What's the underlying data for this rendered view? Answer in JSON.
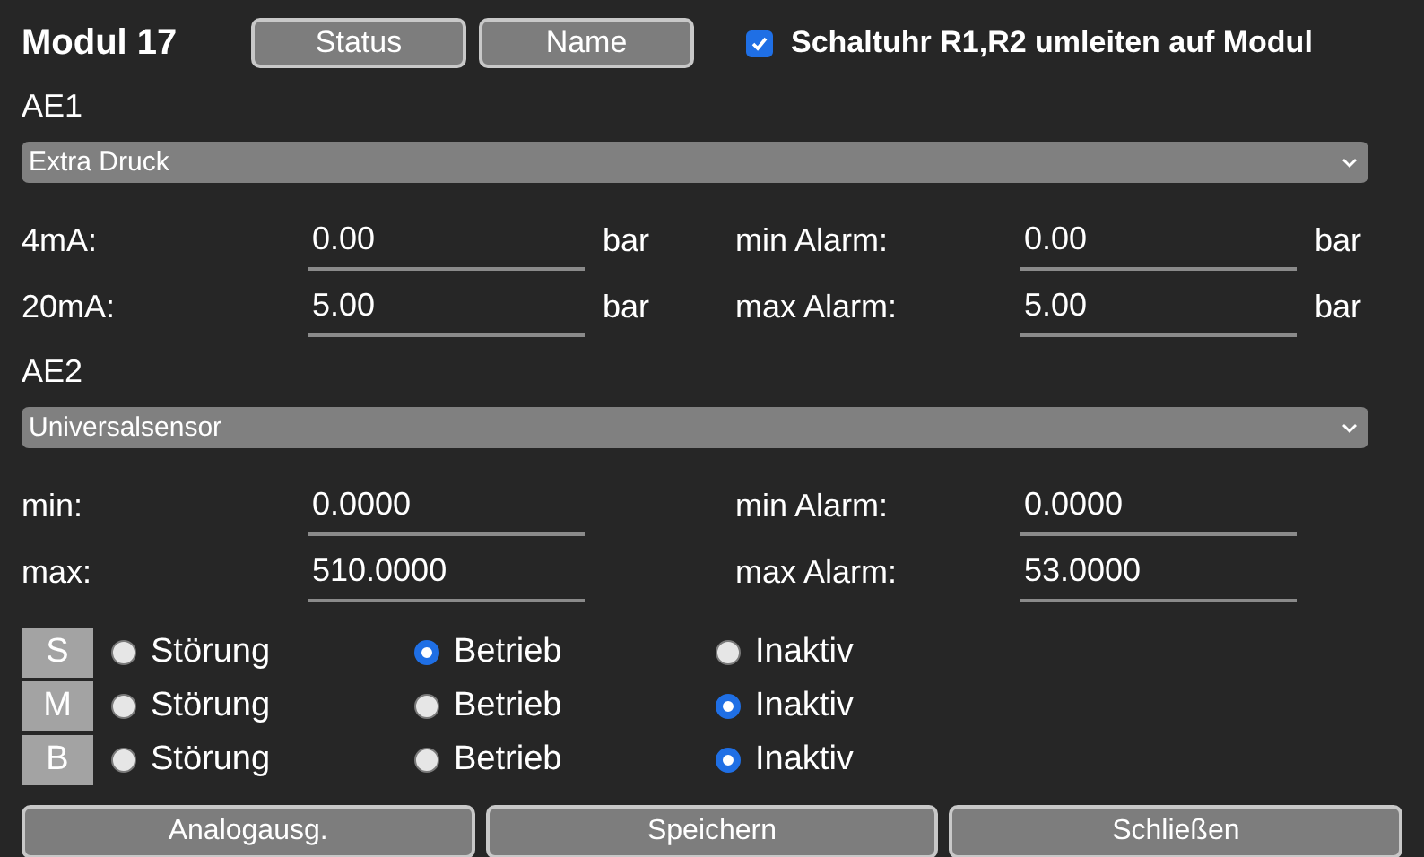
{
  "title": "Modul 17",
  "header_buttons": [
    "Status",
    "Name"
  ],
  "redirect_checkbox": {
    "label": "Schaltuhr R1,R2 umleiten auf Modul",
    "checked": true
  },
  "inputs": [
    {
      "label": "AE1",
      "select": "Extra Druck",
      "rows": [
        [
          {
            "label": "4mA:",
            "value": "0.00",
            "unit": "bar"
          },
          {
            "label": "min Alarm:",
            "value": "0.00",
            "unit": "bar"
          }
        ],
        [
          {
            "label": "20mA:",
            "value": "5.00",
            "unit": "bar"
          },
          {
            "label": "max Alarm:",
            "value": "5.00",
            "unit": "bar"
          }
        ]
      ]
    },
    {
      "label": "AE2",
      "select": "Universalsensor",
      "rows": [
        [
          {
            "label": "min:",
            "value": "0.0000"
          },
          {
            "label": "min Alarm:",
            "value": "0.0000"
          }
        ],
        [
          {
            "label": "max:",
            "value": "510.0000"
          },
          {
            "label": "max Alarm:",
            "value": "53.0000"
          }
        ]
      ]
    }
  ],
  "modes": [
    {
      "badge": "S",
      "options": [
        {
          "label": "Störung",
          "selected": false
        },
        {
          "label": "Betrieb",
          "selected": true
        },
        {
          "label": "Inaktiv",
          "selected": false
        }
      ]
    },
    {
      "badge": "M",
      "options": [
        {
          "label": "Störung",
          "selected": false
        },
        {
          "label": "Betrieb",
          "selected": false
        },
        {
          "label": "Inaktiv",
          "selected": true
        }
      ]
    },
    {
      "badge": "B",
      "options": [
        {
          "label": "Störung",
          "selected": false
        },
        {
          "label": "Betrieb",
          "selected": false
        },
        {
          "label": "Inaktiv",
          "selected": true
        }
      ]
    }
  ],
  "footer_buttons": [
    "Analogausg.",
    "Speichern",
    "Schließen"
  ]
}
